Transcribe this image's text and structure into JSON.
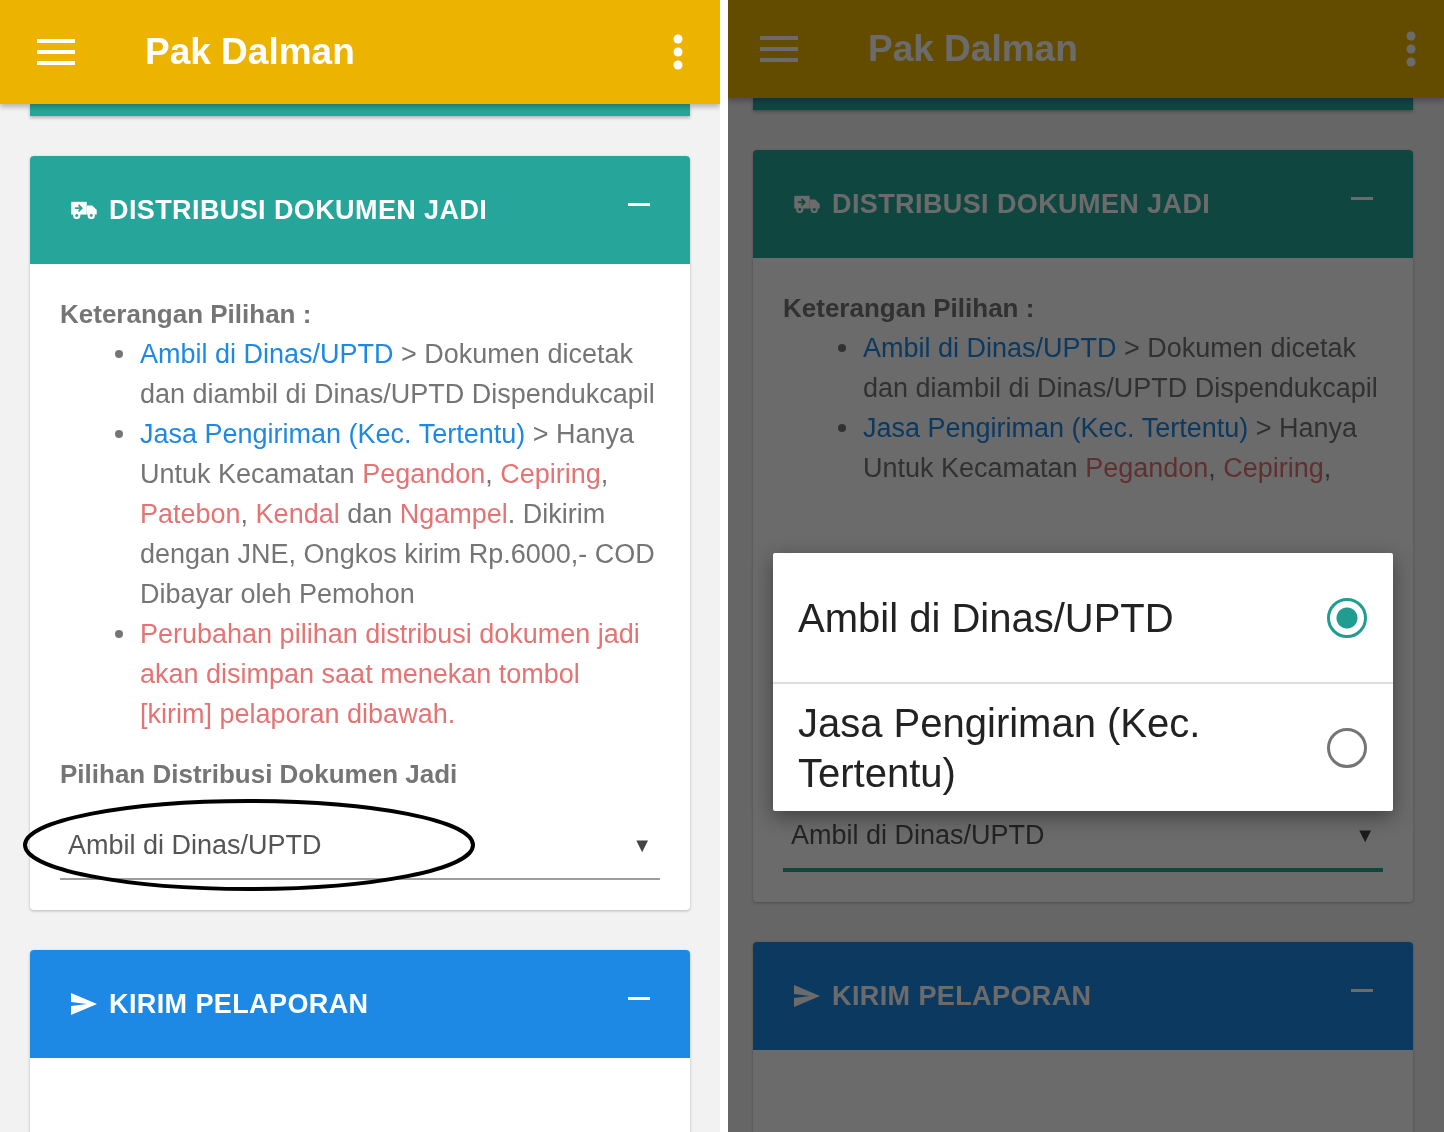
{
  "screens": [
    {
      "app_bar": {
        "title": "Pak Dalman"
      },
      "cards": [
        {
          "kind": "distribution",
          "title": "DISTRIBUSI DOKUMEN JADI",
          "expanded": true,
          "note_heading": "Keterangan Pilihan :",
          "notes": [
            {
              "kind": "plain",
              "parts": [
                {
                  "kind": "link",
                  "text": "Ambil di Dinas/UPTD"
                },
                {
                  "kind": "plain",
                  "text": " > Dokumen dicetak dan diambil di Dinas/UPTD Dispendukcapil"
                }
              ]
            },
            {
              "kind": "plain",
              "parts": [
                {
                  "kind": "link",
                  "text": "Jasa Pengiriman (Kec. Tertentu)"
                },
                {
                  "kind": "plain",
                  "text": " > Hanya Untuk Kecamatan "
                },
                {
                  "kind": "red",
                  "text": "Pegandon"
                },
                {
                  "kind": "plain",
                  "text": ", "
                },
                {
                  "kind": "red",
                  "text": "Cepiring"
                },
                {
                  "kind": "plain",
                  "text": ", "
                },
                {
                  "kind": "red",
                  "text": "Patebon"
                },
                {
                  "kind": "plain",
                  "text": ", "
                },
                {
                  "kind": "red",
                  "text": "Kendal"
                },
                {
                  "kind": "plain",
                  "text": " dan "
                },
                {
                  "kind": "red",
                  "text": "Ngampel"
                },
                {
                  "kind": "plain",
                  "text": ". Dikirim dengan JNE, Ongkos kirim Rp.6000,- COD Dibayar oleh Pemohon"
                }
              ]
            },
            {
              "kind": "warning",
              "parts": [
                {
                  "kind": "plain",
                  "text": "Perubahan pilihan distribusi dokumen jadi akan disimpan saat menekan tombol [kirim] pelaporan dibawah."
                }
              ]
            }
          ],
          "field_label": "Pilihan Distribusi Dokumen Jadi",
          "select": {
            "value": "Ambil di Dinas/UPTD",
            "arrow": "▼",
            "focused": false,
            "annotated": true
          }
        },
        {
          "kind": "send",
          "title": "KIRIM PELAPORAN",
          "expanded": true
        }
      ]
    },
    {
      "app_bar": {
        "title": "Pak Dalman"
      },
      "cards": [
        {
          "kind": "distribution",
          "title": "DISTRIBUSI DOKUMEN JADI",
          "expanded": true,
          "note_heading": "Keterangan Pilihan :",
          "notes": [
            {
              "kind": "plain",
              "parts": [
                {
                  "kind": "link",
                  "text": "Ambil di Dinas/UPTD"
                },
                {
                  "kind": "plain",
                  "text": " > Dokumen dicetak dan diambil di Dinas/UPTD Dispendukcapil"
                }
              ]
            },
            {
              "kind": "plain",
              "parts": [
                {
                  "kind": "link",
                  "text": "Jasa Pengiriman (Kec. Tertentu)"
                },
                {
                  "kind": "plain",
                  "text": " > Hanya Untuk Kecamatan "
                },
                {
                  "kind": "red",
                  "text": "Pegandon"
                },
                {
                  "kind": "plain",
                  "text": ", "
                },
                {
                  "kind": "red",
                  "text": "Cepiring"
                },
                {
                  "kind": "plain",
                  "text": ","
                }
              ]
            }
          ],
          "select": {
            "value": "Ambil di Dinas/UPTD",
            "arrow": "▼",
            "focused": true
          }
        },
        {
          "kind": "send",
          "title": "KIRIM PELAPORAN",
          "expanded": true
        }
      ],
      "dialog": {
        "options": [
          {
            "label": "Ambil di Dinas/UPTD",
            "selected": true
          },
          {
            "label": "Jasa Pengiriman (Kec. Tertentu)",
            "selected": false
          }
        ]
      }
    }
  ]
}
